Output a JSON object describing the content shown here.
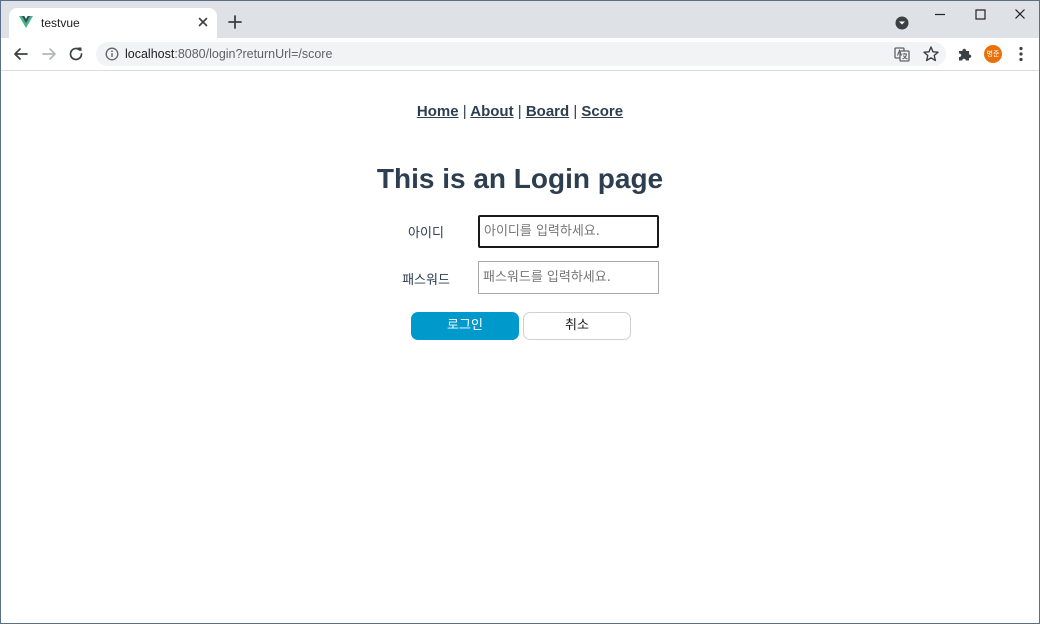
{
  "browser": {
    "tab": {
      "title": "testvue"
    },
    "address_bar": {
      "url_host": "localhost",
      "url_rest": ":8080/login?returnUrl=/score"
    },
    "profile": {
      "avatar_text": "병준",
      "avatar_color": "#e8710a"
    }
  },
  "nav": {
    "links": [
      "Home",
      "About",
      "Board",
      "Score"
    ],
    "separator": "|"
  },
  "login": {
    "heading": "This is an Login page",
    "id_label": "아이디",
    "id_placeholder": "아이디를 입력하세요.",
    "password_label": "패스워드",
    "password_placeholder": "패스워드를 입력하세요.",
    "login_button": "로그인",
    "cancel_button": "취소",
    "login_button_color": "#0099cc",
    "text_color": "#2c3e50"
  }
}
